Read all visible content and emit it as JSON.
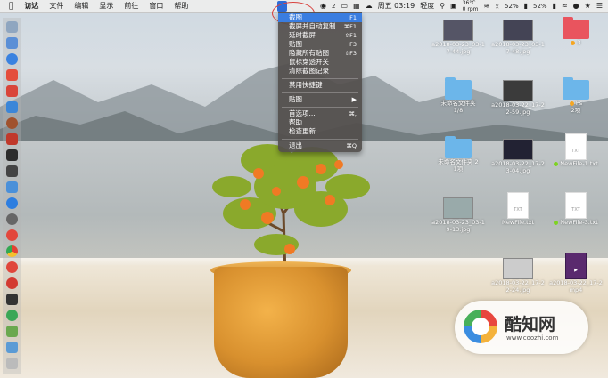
{
  "menubar": {
    "app_name": "访达",
    "items": [
      "文件",
      "编辑",
      "显示",
      "前往",
      "窗口",
      "帮助"
    ],
    "status": {
      "badge_count": "2",
      "datetime": "周五 03:19",
      "input_method": "轻度",
      "battery_percent_1": "52%",
      "battery_percent_2": "52%",
      "temp": "36°C",
      "fan": "0 rpm"
    }
  },
  "menu": {
    "items": [
      {
        "label": "截图",
        "key": "F1",
        "selected": true
      },
      {
        "label": "截屏并自动复制",
        "key": "⌘F1"
      },
      {
        "label": "延时截屏",
        "key": "⇧F1"
      },
      {
        "label": "贴图",
        "key": "F3"
      },
      {
        "label": "隐藏所有贴图",
        "key": "⇧F3"
      },
      {
        "label": "鼠标穿透开关",
        "key": ""
      },
      {
        "label": "清除截图记录",
        "key": ""
      },
      {
        "label": "禁用快捷键",
        "key": ""
      },
      {
        "label": "贴图",
        "key": "",
        "submenu": true
      },
      {
        "label": "首选项...",
        "key": "⌘,"
      },
      {
        "label": "帮助",
        "key": ""
      },
      {
        "label": "检查更新...",
        "key": ""
      },
      {
        "label": "退出",
        "key": "⌘Q"
      }
    ]
  },
  "desktop_files": [
    {
      "name": "a2018-03-23_03-1",
      "name2": "7-44.jpg",
      "type": "image"
    },
    {
      "name": "a2018-03-23_03-1",
      "name2": "7-48.jpg",
      "type": "image"
    },
    {
      "name": "3",
      "name2": "",
      "type": "folder-red"
    },
    {
      "name": "未命名文件夹",
      "name2": "1/8",
      "type": "folder"
    },
    {
      "name": "a2018-03-22_17-2",
      "name2": "2-59.jpg",
      "type": "image"
    },
    {
      "name": "Ps",
      "name2": "2项",
      "type": "folder"
    },
    {
      "name": "未命名文件夹 2",
      "name2": "1项",
      "type": "folder"
    },
    {
      "name": "a2018-03-22_17-2",
      "name2": "3-04.jpg",
      "type": "image"
    },
    {
      "name": "NewFile-1.txt",
      "name2": "",
      "type": "doc"
    },
    {
      "name": "a2018-03-23_03-1",
      "name2": "9-13.jpg",
      "type": "image"
    },
    {
      "name": "NewFile.txt",
      "name2": "",
      "type": "doc"
    },
    {
      "name": "NewFile-3.txt",
      "name2": "",
      "type": "doc"
    },
    {
      "name": "a2018-03-22_17-2",
      "name2": "2-24.jpg",
      "type": "image"
    },
    {
      "name": "a2018-03-22_17-2",
      "name2": "mp4",
      "type": "video"
    }
  ],
  "watermark": {
    "title": "酷知网",
    "url": "www.coozhi.com"
  },
  "colors": {
    "menu_bg": "#524e4c",
    "menu_highlight": "#3a7de0",
    "annotation_red": "#d8433f"
  }
}
